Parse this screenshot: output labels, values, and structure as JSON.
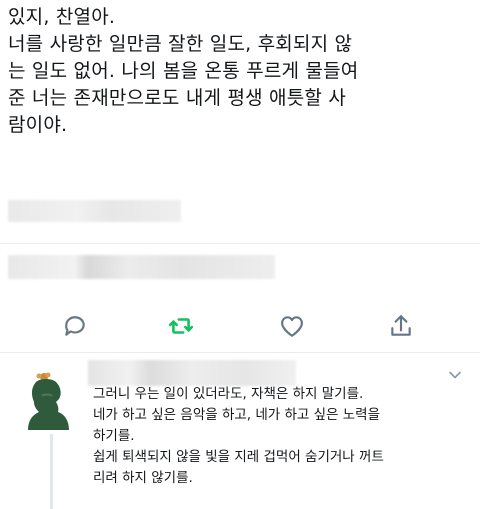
{
  "tweet": {
    "lines": [
      "있지, 찬열아.",
      "너를 사랑한 일만큼 잘한 일도, 후회되지 않",
      "는 일도 없어. 나의 봄을 온통 푸르게 물들여",
      "준 너는 존재만으로도 내게 평생 애틋할 사",
      "람이야."
    ]
  },
  "actions": {
    "reply": "reply-icon",
    "retweet": "retweet-icon",
    "like": "heart-icon",
    "share": "share-icon",
    "retweet_color": "#17bf63",
    "icon_color": "#657786"
  },
  "reply": {
    "lines": [
      "그러니 우는 일이 있더라도, 자책은 하지 말기를.",
      "네가 하고 싶은 음악을 하고, 네가 하고 싶은 노력을",
      "하기를.",
      "쉽게 퇴색되지 않을 빛을 지레 겁먹어 숨기거나 꺼트",
      "리려 하지 않기를."
    ]
  }
}
